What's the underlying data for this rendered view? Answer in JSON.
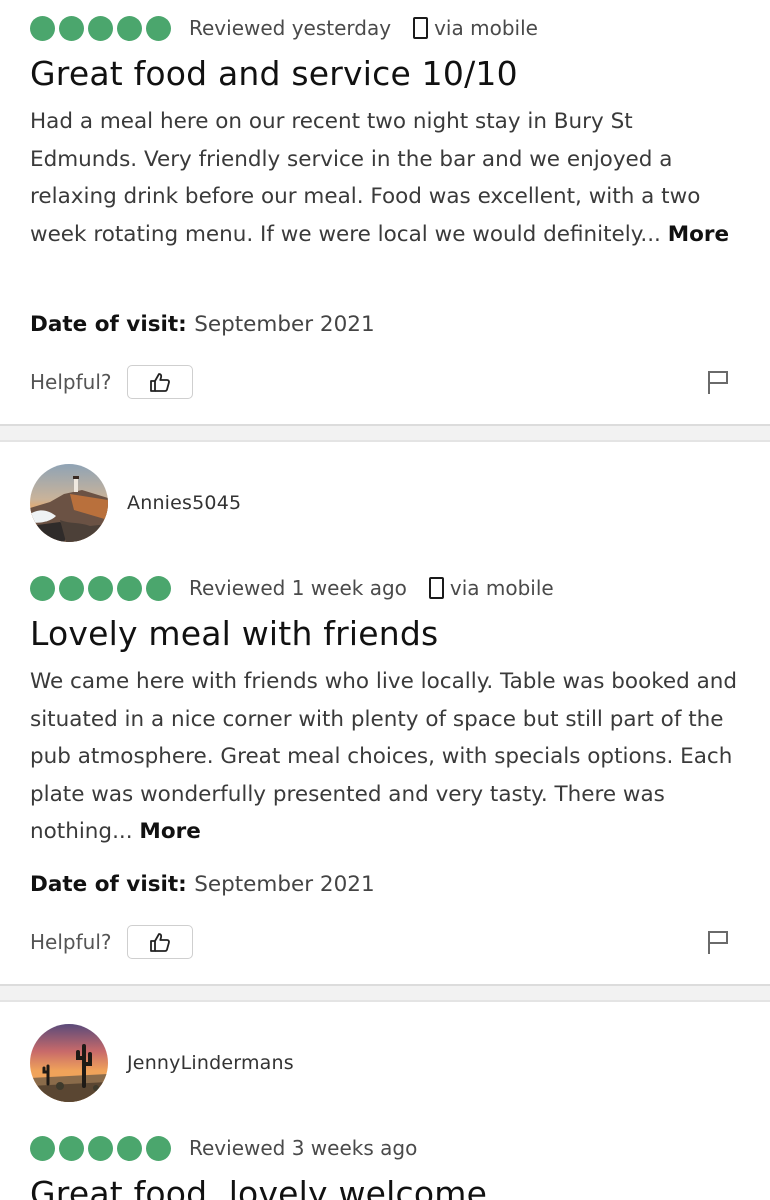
{
  "reviews": [
    {
      "rating_bubbles": 5,
      "reviewed": "Reviewed yesterday",
      "via": "via mobile",
      "title": "Great food and service 10/10",
      "body": "Had a meal here on our recent two night stay in Bury St Edmunds. Very friendly service in the bar and we enjoyed a relaxing drink before our meal. Food was excellent, with a two week rotating menu. If we were local we would definitely...",
      "more": "More",
      "date_label": "Date of visit:",
      "date_value": "September 2021",
      "helpful": "Helpful?"
    },
    {
      "username": "Annies5045",
      "rating_bubbles": 5,
      "reviewed": "Reviewed 1 week ago",
      "via": "via mobile",
      "title": "Lovely meal with friends",
      "body": "We came here with friends who live locally. Table was booked and situated in a nice corner with plenty of space but still part of the pub atmosphere. Great meal choices, with specials options. Each plate was wonderfully presented and very tasty. There was nothing...",
      "more": "More",
      "date_label": "Date of visit:",
      "date_value": "September 2021",
      "helpful": "Helpful?"
    },
    {
      "username": "JennyLindermans",
      "rating_bubbles": 5,
      "reviewed": "Reviewed 3 weeks ago",
      "title": "Great food, lovely welcome"
    }
  ],
  "colors": {
    "bubble": "#4ba66d",
    "separator": "#f2f2f2"
  }
}
